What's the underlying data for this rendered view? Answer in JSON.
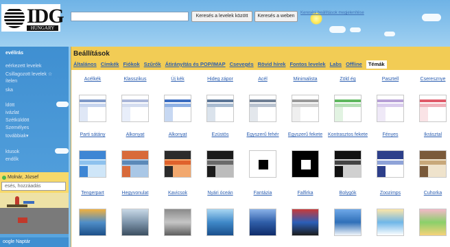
{
  "header": {
    "logo_title": "IDG",
    "logo_subtitle": "HUNGARY",
    "search_placeholder": "",
    "search_mail_button": "Keresés a levelek között",
    "search_web_button": "Keresés a weben",
    "advanced_search_link": "Keresési beállítások megjelenítése"
  },
  "sidebar": {
    "items": [
      {
        "label": "evélírás"
      },
      {
        "label": "eérkezett levelek"
      },
      {
        "label": "Csillagozott levelek ☆"
      },
      {
        "label": "ítelen"
      },
      {
        "label": "ska"
      },
      {
        "label": "ldött"
      },
      {
        "label": "ivázlat"
      },
      {
        "label": "Szétküldött"
      },
      {
        "label": "Személyes"
      },
      {
        "label": "továbbiak▾"
      },
      {
        "label": "ktusok"
      },
      {
        "label": "endők"
      }
    ],
    "contact_name": "Molnár, József",
    "contact_search_placeholder": "esés, hozzáadás",
    "calendar_label": "oogle Naptár"
  },
  "panel": {
    "title": "Beállítások",
    "tabs": [
      {
        "label": "Általános",
        "active": false
      },
      {
        "label": "Címkék",
        "active": false
      },
      {
        "label": "Fiókok",
        "active": false
      },
      {
        "label": "Szűrők",
        "active": false
      },
      {
        "label": "Átirányítás és POP/IMAP",
        "active": false
      },
      {
        "label": "Csevegés",
        "active": false
      },
      {
        "label": "Rövid hírek",
        "active": false
      },
      {
        "label": "Fontos levelek",
        "active": false
      },
      {
        "label": "Labs",
        "active": false
      },
      {
        "label": "Offline",
        "active": false
      },
      {
        "label": "Témák",
        "active": true
      }
    ],
    "themes_row1": [
      {
        "name": "Acélkék",
        "colors": [
          "#7f99c8",
          "#c6d4ee",
          "#dfe7f6"
        ]
      },
      {
        "name": "Klasszikus",
        "colors": [
          "#a9b6d8",
          "#d4ddf0",
          "#e8eefa"
        ]
      },
      {
        "name": "Új kék",
        "colors": [
          "#3a6cc0",
          "#8fb1e4",
          "#c7d8f2"
        ]
      },
      {
        "name": "Hideg zápor",
        "colors": [
          "#5c7697",
          "#a9bbd0",
          "#dbe3ec"
        ]
      },
      {
        "name": "Acél",
        "colors": [
          "#6f7f94",
          "#b8c2cf",
          "#e3e7ec"
        ]
      },
      {
        "name": "Minimalista",
        "colors": [
          "#9a9a9a",
          "#d2d2d2",
          "#efefef"
        ]
      },
      {
        "name": "Zöld ég",
        "colors": [
          "#5fb85f",
          "#b7e0b7",
          "#e2f3e2"
        ]
      },
      {
        "name": "Pasztell",
        "colors": [
          "#b7a0d6",
          "#dacdee",
          "#efe9f7"
        ]
      },
      {
        "name": "Cseresznye",
        "colors": [
          "#e05a6a",
          "#f1b3bb",
          "#fae3e6"
        ]
      }
    ],
    "themes_row2": [
      {
        "name": "Parti sátány",
        "colors": [
          "#3e86d4",
          "#8ec2ee",
          "#cfe6f8"
        ]
      },
      {
        "name": "Alkonyat",
        "colors": [
          "#d86a3a",
          "#5b89b8",
          "#a9c7e6"
        ]
      },
      {
        "name": "Alkonyat",
        "colors": [
          "#2b2b2b",
          "#e0622c",
          "#f2a86e"
        ]
      },
      {
        "name": "Ezüstös",
        "colors": [
          "#1c1c1c",
          "#6a6a6a",
          "#bcbcbc"
        ]
      },
      {
        "name": "Egyszerű fehér",
        "colors": [
          "#000000",
          "#ffffff",
          "#000000"
        ]
      },
      {
        "name": "Egyszerű fekete",
        "colors": [
          "#000000",
          "#ffffff",
          "#000000"
        ]
      },
      {
        "name": "Kontrasztos fekete",
        "colors": [
          "#111111",
          "#444444",
          "#d0d0d0"
        ]
      },
      {
        "name": "Fényes",
        "colors": [
          "#2d3f8a",
          "#8fa3d8",
          "#ffffff"
        ]
      },
      {
        "name": "Ikrásztal",
        "colors": [
          "#7a5a3a",
          "#c8a87a",
          "#efe3cc"
        ]
      }
    ],
    "themes_row3": [
      {
        "name": "Tengerpart",
        "colors": [
          "#f0b040",
          "#4f8ec8",
          "#1c4f88"
        ]
      },
      {
        "name": "Hegyvonulat",
        "colors": [
          "#c8d8e6",
          "#7e95ab",
          "#3c4e60"
        ]
      },
      {
        "name": "Kavicsok",
        "colors": [
          "#8a8a8a",
          "#c6c6c6",
          "#5e5e5e"
        ]
      },
      {
        "name": "Nyári óceán",
        "colors": [
          "#a8d6f2",
          "#3f88c8",
          "#1a4f8c"
        ]
      },
      {
        "name": "Fantázia",
        "colors": [
          "#8ab2e8",
          "#2f5ea8",
          "#0f2c6a"
        ]
      },
      {
        "name": "Falfirka",
        "colors": [
          "#c83a3a",
          "#2b5fb8",
          "#1c1c1c"
        ]
      },
      {
        "name": "Bolygók",
        "colors": [
          "#6fa8e8",
          "#2f6fb8",
          "#f2f6fa"
        ]
      },
      {
        "name": "Zoozimps",
        "colors": [
          "#fde6a8",
          "#6fb6e8",
          "#ffffff"
        ]
      },
      {
        "name": "Cuhorka",
        "colors": [
          "#f3b9c8",
          "#8ad06a",
          "#f6d27a"
        ]
      }
    ]
  }
}
